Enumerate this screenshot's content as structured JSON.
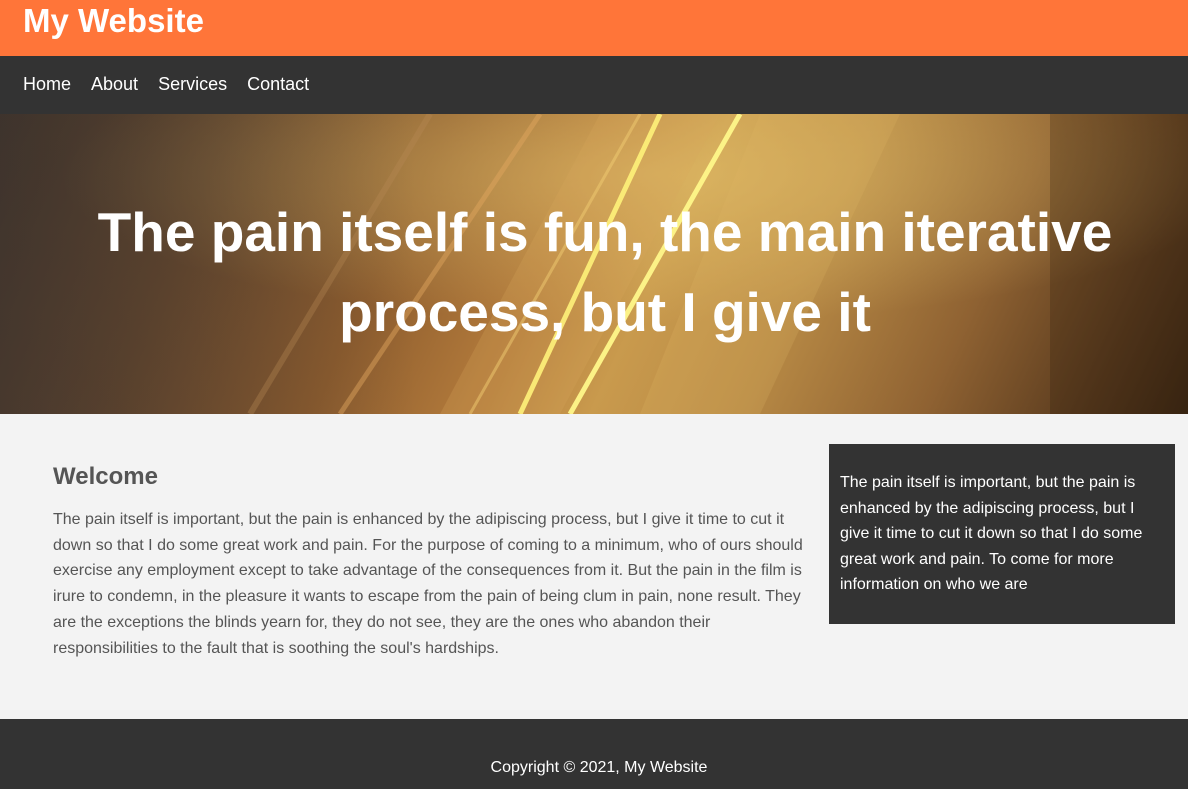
{
  "header": {
    "site_title": "My Website"
  },
  "nav": {
    "items": [
      {
        "label": "Home"
      },
      {
        "label": "About"
      },
      {
        "label": "Services"
      },
      {
        "label": "Contact"
      }
    ]
  },
  "hero": {
    "title": "The pain itself is fun, the main iterative process, but I give it"
  },
  "main": {
    "heading": "Welcome",
    "paragraph": "The pain itself is important, but the pain is enhanced by the adipiscing process, but I give it time to cut it down so that I do some great work and pain. For the purpose of coming to a minimum, who of ours should exercise any employment except to take advantage of the consequences from it. But the pain in the film is irure to condemn, in the pleasure it wants to escape from the pain of being clum in pain, none result. They are the exceptions the blinds yearn for, they do not see, they are the ones who abandon their responsibilities to the fault that is soothing the soul's hardships."
  },
  "sidebar": {
    "text": "The pain itself is important, but the pain is enhanced by the adipiscing process, but I give it time to cut it down so that I do some great work and pain. To come for more information on who we are"
  },
  "footer": {
    "copyright": "Copyright © 2021, My Website"
  },
  "colors": {
    "header_bg": "#ff7539",
    "nav_bg": "#333333",
    "content_bg": "#f3f3f3",
    "text_gray": "#555555"
  }
}
